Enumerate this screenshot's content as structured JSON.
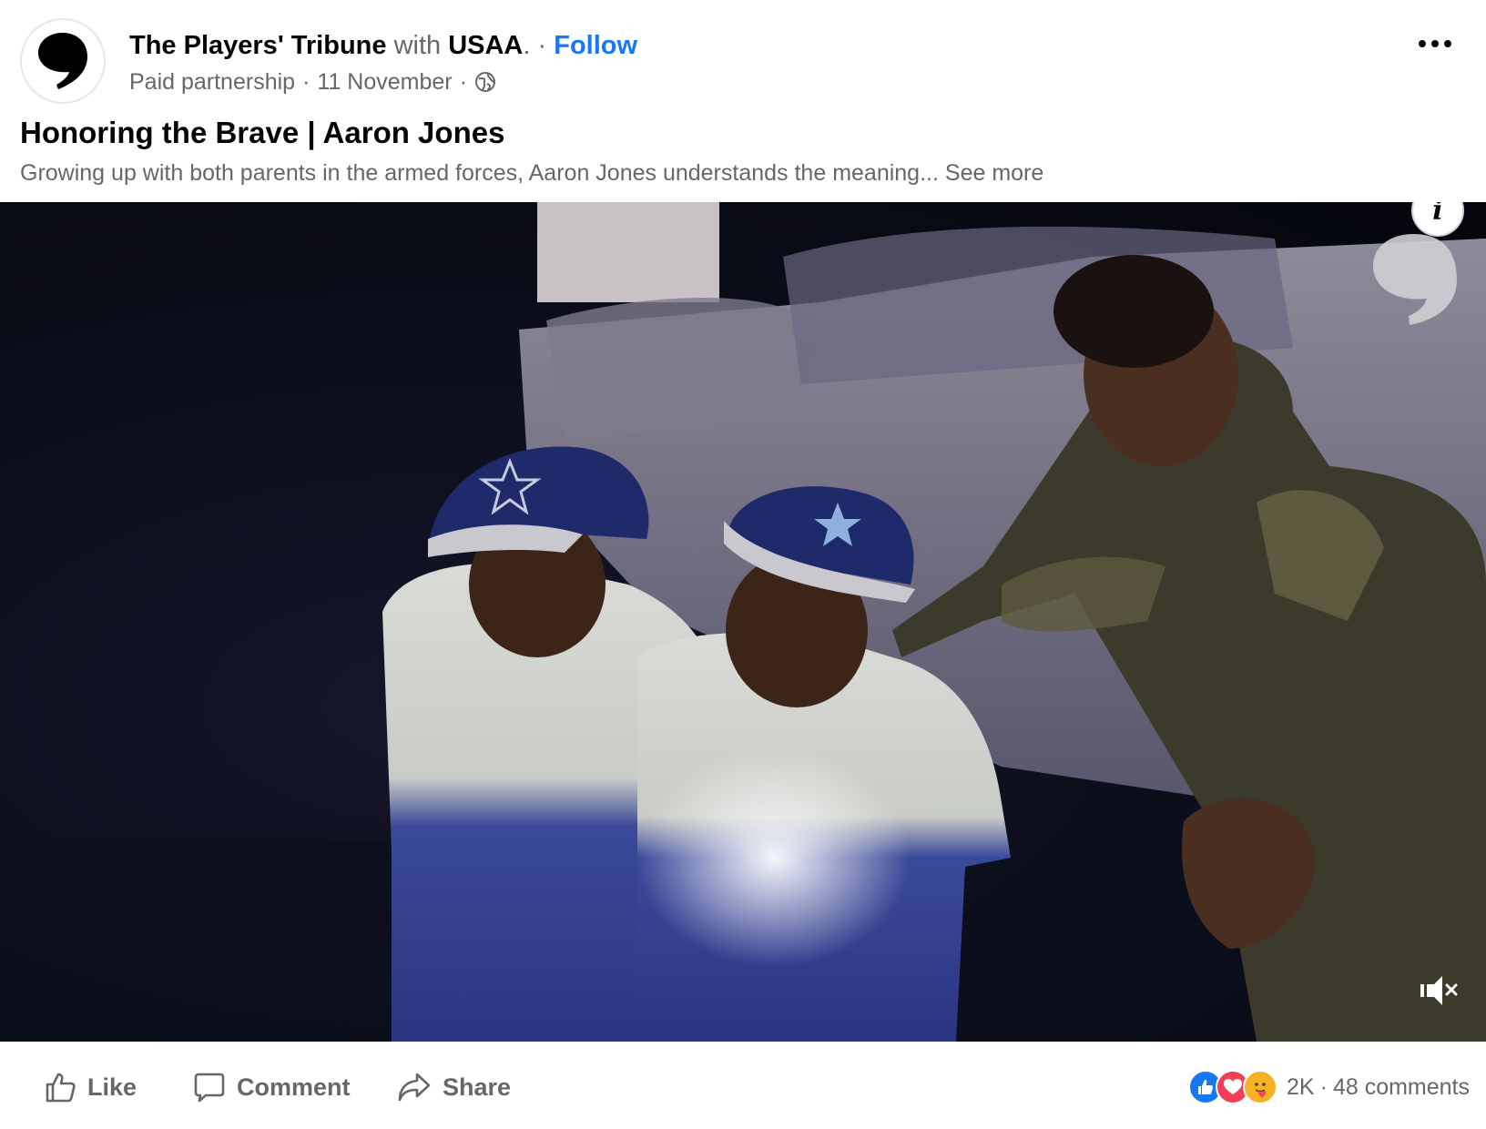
{
  "header": {
    "page_name": "The Players' Tribune",
    "with_text": "with",
    "partner_name": "USAA",
    "partner_suffix": ".",
    "separator": "·",
    "follow_label": "Follow",
    "sponsor_label": "Paid partnership",
    "date": "11 November",
    "audience_icon": "globe-icon"
  },
  "post": {
    "title": "Honoring the Brave | Aaron Jones",
    "description": "Growing up with both parents in the armed forces, Aaron Jones understands the meaning...",
    "see_more_label": "See more"
  },
  "media": {
    "type": "video",
    "info_icon_label": "i",
    "mute_icon": "speaker-muted-icon"
  },
  "actions": {
    "like_label": "Like",
    "comment_label": "Comment",
    "share_label": "Share"
  },
  "engagement": {
    "reaction_icons": [
      "like-reaction-icon",
      "love-reaction-icon",
      "care-reaction-icon"
    ],
    "reaction_count": "2K",
    "separator": "·",
    "comment_count": "48 comments"
  },
  "colors": {
    "link_blue": "#1877f2",
    "secondary_text": "#65676b",
    "like_blue": "#1877f2",
    "love_red": "#f33e58",
    "care_yellow": "#f7b125"
  }
}
